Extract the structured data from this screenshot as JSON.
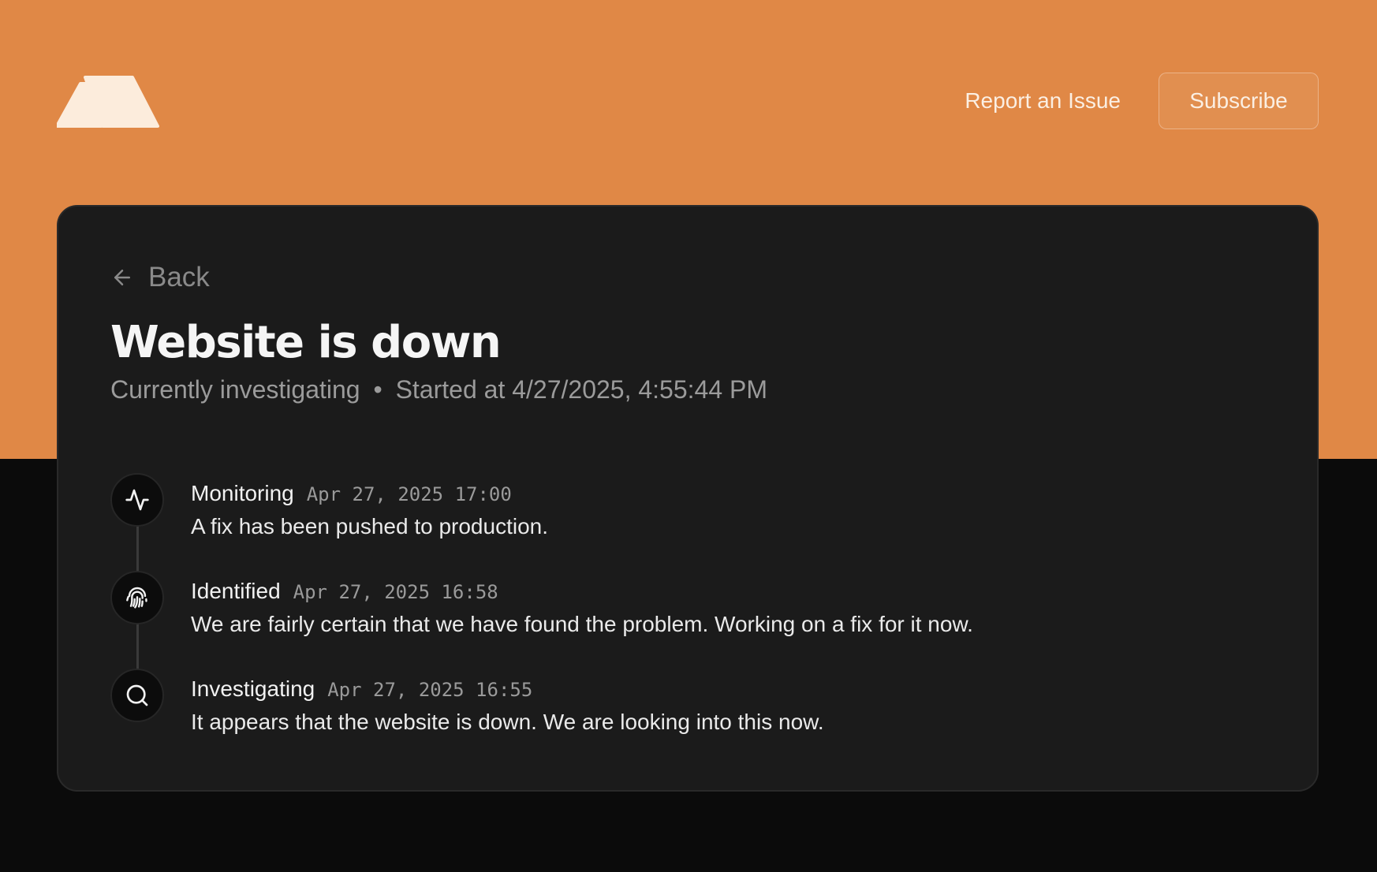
{
  "colors": {
    "brand_orange": "#e08846",
    "card_bg": "#1b1b1b",
    "page_bg": "#0b0b0b"
  },
  "header": {
    "logo": "mountain-logo",
    "report_label": "Report an Issue",
    "subscribe_label": "Subscribe"
  },
  "incident": {
    "back_label": "Back",
    "title": "Website is down",
    "status": "Currently investigating",
    "separator": "•",
    "started": "Started at 4/27/2025, 4:55:44 PM"
  },
  "updates": [
    {
      "icon": "activity-icon",
      "status": "Monitoring",
      "time": "Apr 27, 2025 17:00",
      "message": "A fix has been pushed to production."
    },
    {
      "icon": "fingerprint-icon",
      "status": "Identified",
      "time": "Apr 27, 2025 16:58",
      "message": "We are fairly certain that we have found the problem. Working on a fix for it now."
    },
    {
      "icon": "search-icon",
      "status": "Investigating",
      "time": "Apr 27, 2025 16:55",
      "message": "It appears that the website is down. We are looking into this now."
    }
  ]
}
